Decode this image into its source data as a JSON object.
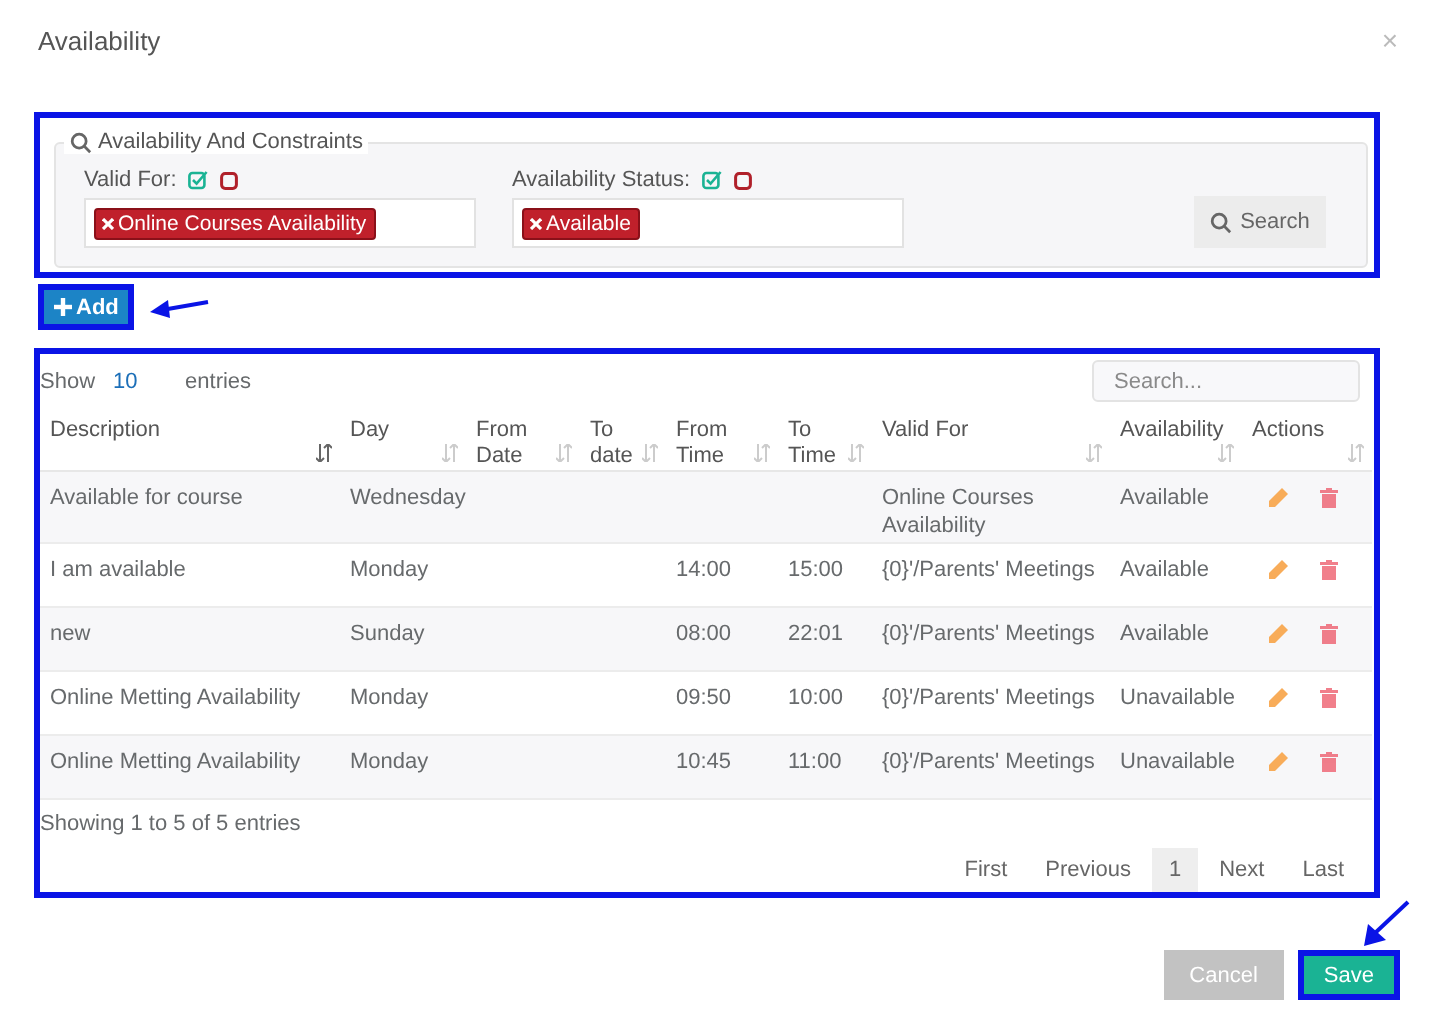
{
  "dialog": {
    "title": "Availability",
    "close": "×"
  },
  "filter": {
    "highlighted": true,
    "legend": "Availability And Constraints",
    "fields": [
      {
        "label": "Valid For:",
        "tags": [
          "Online Courses Availability"
        ]
      },
      {
        "label": "Availability Status:",
        "tags": [
          "Available"
        ]
      }
    ],
    "search_button": "Search"
  },
  "add_button": {
    "label": "Add",
    "highlighted": true,
    "arrow": true
  },
  "table": {
    "highlighted": true,
    "length_label": "Show",
    "length_value": "10",
    "length_suffix": "entries",
    "search_placeholder": "Search...",
    "columns": [
      {
        "label": "Description",
        "sorted": true
      },
      {
        "label": "Day",
        "sorted": false
      },
      {
        "label": "From Date",
        "sorted": false
      },
      {
        "label": "To date",
        "sorted": false
      },
      {
        "label": "From Time",
        "sorted": false
      },
      {
        "label": "To Time",
        "sorted": false
      },
      {
        "label": "Valid For",
        "sorted": false
      },
      {
        "label": "Availability",
        "sorted": false
      },
      {
        "label": "Actions",
        "sorted": false
      }
    ],
    "rows": [
      {
        "cells": [
          "Available for course",
          "Wednesday",
          "",
          "",
          "",
          "",
          "Online Courses Availability",
          "Available"
        ]
      },
      {
        "cells": [
          "I am available",
          "Monday",
          "",
          "",
          "14:00",
          "15:00",
          "{0}'/Parents' Meetings",
          "Available"
        ]
      },
      {
        "cells": [
          "new",
          "Sunday",
          "",
          "",
          "08:00",
          "22:01",
          "{0}'/Parents' Meetings",
          "Available"
        ]
      },
      {
        "cells": [
          "Online Metting Availability",
          "Monday",
          "",
          "",
          "09:50",
          "10:00",
          "{0}'/Parents' Meetings",
          "Unavailable"
        ]
      },
      {
        "cells": [
          "Online Metting Availability",
          "Monday",
          "",
          "",
          "10:45",
          "11:00",
          "{0}'/Parents' Meetings",
          "Unavailable"
        ]
      }
    ],
    "info": "Showing 1 to 5 of 5 entries",
    "pagination": [
      {
        "label": "First",
        "selected": false
      },
      {
        "label": "Previous",
        "selected": false
      },
      {
        "label": "1",
        "selected": true
      },
      {
        "label": "Next",
        "selected": false
      },
      {
        "label": "Last",
        "selected": false
      }
    ]
  },
  "footer": {
    "buttons": [
      {
        "label": "Cancel",
        "kind": "secondary",
        "highlighted": false,
        "arrow": false
      },
      {
        "label": "Save",
        "kind": "primary",
        "highlighted": true,
        "arrow": true
      }
    ]
  }
}
